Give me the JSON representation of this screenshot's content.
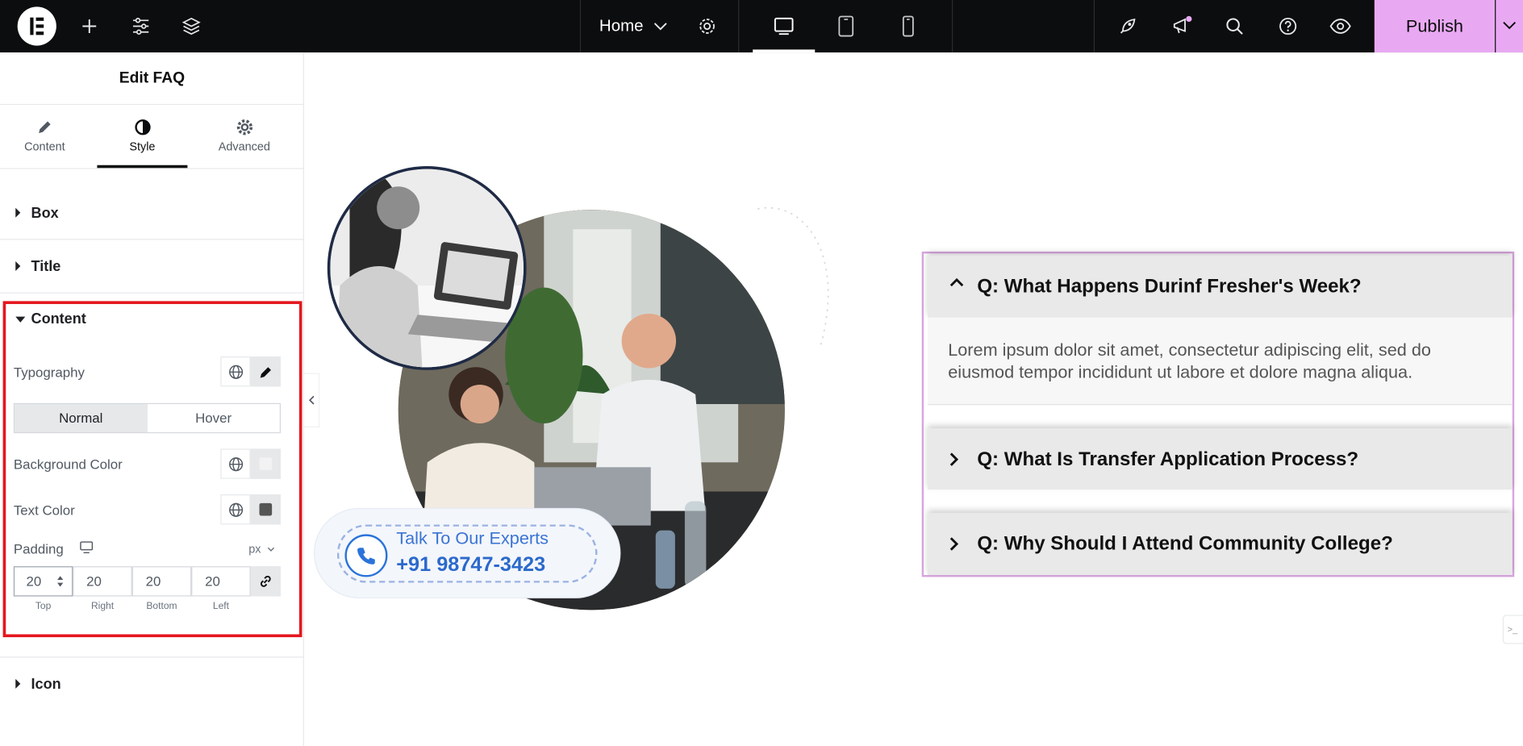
{
  "topbar": {
    "page_name": "Home",
    "publish_label": "Publish"
  },
  "panel": {
    "title": "Edit FAQ",
    "tabs": [
      {
        "label": "Content"
      },
      {
        "label": "Style"
      },
      {
        "label": "Advanced"
      }
    ],
    "sections": {
      "box": "Box",
      "title": "Title",
      "content": "Content",
      "icon": "Icon"
    },
    "content_controls": {
      "typography": "Typography",
      "state_normal": "Normal",
      "state_hover": "Hover",
      "background_color": "Background Color",
      "text_color": "Text Color",
      "padding": "Padding",
      "unit": "px",
      "padding_values": {
        "top": "20",
        "right": "20",
        "bottom": "20",
        "left": "20"
      },
      "padding_labels": {
        "top": "Top",
        "right": "Right",
        "bottom": "Bottom",
        "left": "Left"
      }
    }
  },
  "canvas": {
    "cta": {
      "line1": "Talk To Our Experts",
      "line2": "+91 98747-3423"
    },
    "faq": [
      {
        "question": "Q: What Happens Durinf Fresher's Week?",
        "answer": "Lorem ipsum dolor sit amet, consectetur adipiscing elit, sed do eiusmod tempor incididunt ut labore et dolore magna aliqua.",
        "expanded": true
      },
      {
        "question": "Q: What Is Transfer Application Process?",
        "expanded": false
      },
      {
        "question": "Q: Why Should I Attend Community College?",
        "expanded": false
      }
    ],
    "side_tab": ">_"
  },
  "colors": {
    "publish_bg": "#e9a9f2",
    "highlight_border": "#e4161d",
    "faq_frame": "#d7a6de",
    "cta_blue": "#2b69cc"
  }
}
